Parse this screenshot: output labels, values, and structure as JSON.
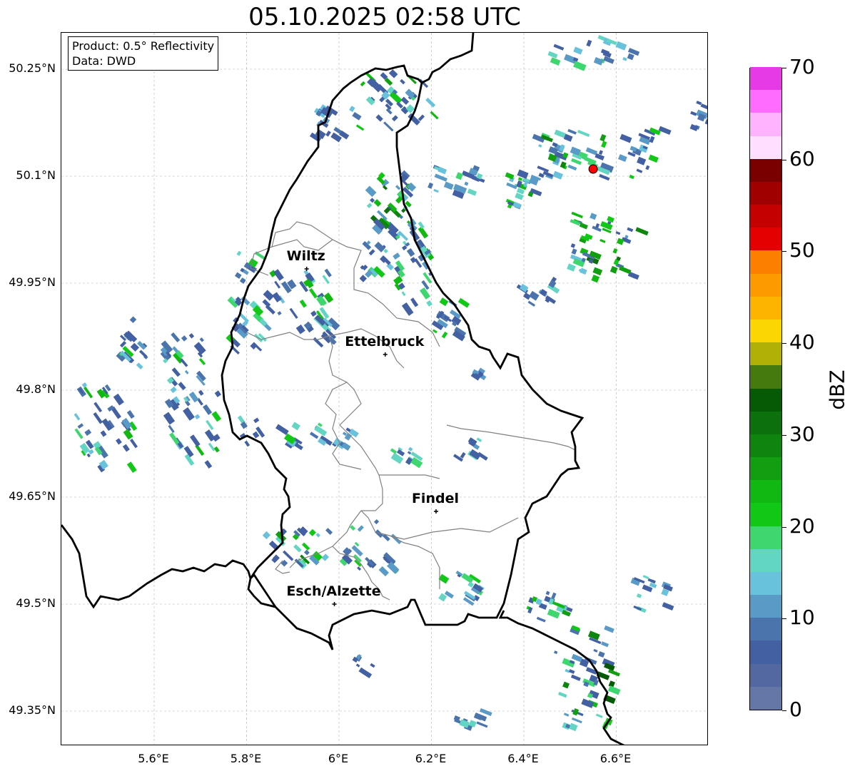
{
  "title": "05.10.2025 02:58 UTC",
  "info": {
    "product": "Product: 0.5° Reflectivity",
    "data": "Data: DWD"
  },
  "y_axis_labels": [
    "50.25°N",
    "50.1°N",
    "49.95°N",
    "49.8°N",
    "49.65°N",
    "49.5°N",
    "49.35°N"
  ],
  "x_axis_labels": [
    "5.6°E",
    "5.8°E",
    "6°E",
    "6.2°E",
    "6.4°E",
    "6.6°E"
  ],
  "cities": [
    {
      "name": "Wiltz",
      "lon": 5.93,
      "lat": 49.97
    },
    {
      "name": "Ettelbruck",
      "lon": 6.1,
      "lat": 49.85
    },
    {
      "name": "Findel",
      "lon": 6.21,
      "lat": 49.63
    },
    {
      "name": "Esch/Alzette",
      "lon": 5.99,
      "lat": 49.5
    }
  ],
  "radar_site": {
    "lon": 6.55,
    "lat": 50.11,
    "color": "#ff0000"
  },
  "colorbar": {
    "label": "dBZ",
    "min": 0,
    "max": 70,
    "tick_labels": [
      "0",
      "10",
      "20",
      "30",
      "40",
      "50",
      "60",
      "70"
    ],
    "colors": [
      "#6577a6",
      "#5367a0",
      "#4360a2",
      "#4a74ab",
      "#5a9ac6",
      "#69c2db",
      "#62d6c3",
      "#3ed66f",
      "#12c817",
      "#12b812",
      "#119e11",
      "#0e850e",
      "#0c700c",
      "#065a06",
      "#457a0f",
      "#b0b006",
      "#fcd600",
      "#fcb400",
      "#fc9a00",
      "#fc7f00",
      "#e40000",
      "#c40000",
      "#a00000",
      "#7a0000",
      "#ffdfff",
      "#ffb3ff",
      "#ff6cff",
      "#e63ae6"
    ]
  }
}
